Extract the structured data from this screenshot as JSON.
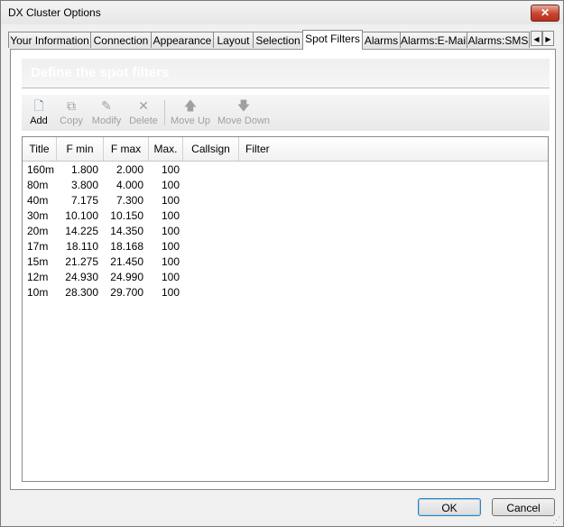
{
  "window": {
    "title": "DX Cluster Options",
    "close_label": "✕"
  },
  "tabs": [
    {
      "label": "Your Information"
    },
    {
      "label": "Connection"
    },
    {
      "label": "Appearance"
    },
    {
      "label": "Layout"
    },
    {
      "label": "Selection"
    },
    {
      "label": "Spot Filters",
      "active": true
    },
    {
      "label": "Alarms"
    },
    {
      "label": "Alarms:E-Mail"
    },
    {
      "label": "Alarms:SMS"
    }
  ],
  "tab_scroll": {
    "left": "◀",
    "right": "▶"
  },
  "page": {
    "header": "Define the spot filters",
    "toolbar": [
      {
        "label": "Add",
        "icon": "new-document-icon",
        "glyph": "🗋",
        "enabled": true
      },
      {
        "label": "Copy",
        "icon": "copy-icon",
        "glyph": "⧉",
        "enabled": false
      },
      {
        "label": "Modify",
        "icon": "edit-icon",
        "glyph": "✎",
        "enabled": false
      },
      {
        "label": "Delete",
        "icon": "delete-icon",
        "glyph": "✕",
        "enabled": false
      },
      {
        "label": "Move Up",
        "icon": "arrow-up-icon",
        "glyph": "🡅",
        "enabled": false
      },
      {
        "label": "Move Down",
        "icon": "arrow-down-icon",
        "glyph": "🡇",
        "enabled": false
      }
    ],
    "table": {
      "columns": [
        "Title",
        "F min",
        "F max",
        "Max.",
        "Callsign",
        "Filter"
      ],
      "rows": [
        [
          "160m",
          "1.800",
          "2.000",
          "100",
          "",
          ""
        ],
        [
          "80m",
          "3.800",
          "4.000",
          "100",
          "",
          ""
        ],
        [
          "40m",
          "7.175",
          "7.300",
          "100",
          "",
          ""
        ],
        [
          "30m",
          "10.100",
          "10.150",
          "100",
          "",
          ""
        ],
        [
          "20m",
          "14.225",
          "14.350",
          "100",
          "",
          ""
        ],
        [
          "17m",
          "18.110",
          "18.168",
          "100",
          "",
          ""
        ],
        [
          "15m",
          "21.275",
          "21.450",
          "100",
          "",
          ""
        ],
        [
          "12m",
          "24.930",
          "24.990",
          "100",
          "",
          ""
        ],
        [
          "10m",
          "28.300",
          "29.700",
          "100",
          "",
          ""
        ]
      ]
    }
  },
  "buttons": {
    "ok": "OK",
    "cancel": "Cancel"
  },
  "colors": {
    "close": "#c8432f",
    "disabled_text": "#a0a0a0",
    "default_border": "#3c7fb1"
  }
}
